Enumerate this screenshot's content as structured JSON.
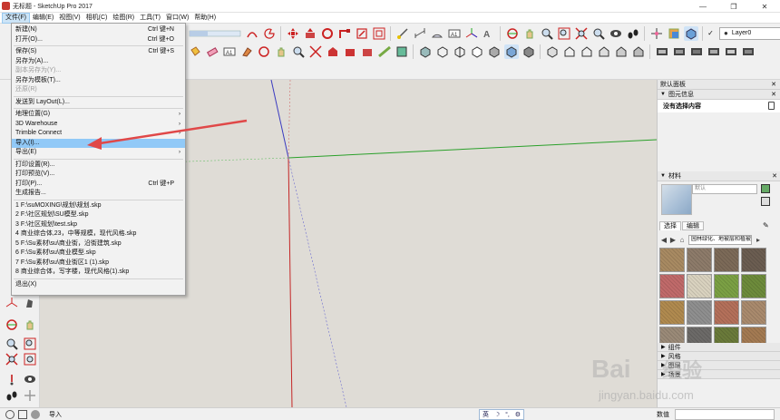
{
  "window": {
    "title": "无标题 - SketchUp Pro 2017",
    "controls": [
      "—",
      "❐",
      "✕"
    ]
  },
  "menubar": [
    "文件(F)",
    "编辑(E)",
    "视图(V)",
    "相机(C)",
    "绘图(R)",
    "工具(T)",
    "窗口(W)",
    "帮助(H)"
  ],
  "file_menu": [
    {
      "label": "新建(N)",
      "shortcut": "Ctrl 键+N"
    },
    {
      "label": "打开(O)...",
      "shortcut": "Ctrl 键+O"
    },
    {
      "sep": true
    },
    {
      "label": "保存(S)",
      "shortcut": "Ctrl 键+S"
    },
    {
      "label": "另存为(A)..."
    },
    {
      "label": "副本另存为(Y)...",
      "disabled": true
    },
    {
      "label": "另存为模板(T)..."
    },
    {
      "label": "还原(R)",
      "disabled": true
    },
    {
      "sep": true
    },
    {
      "label": "发送到 LayOut(L)..."
    },
    {
      "sep": true
    },
    {
      "label": "地理位置(G)",
      "submenu": true
    },
    {
      "label": "3D Warehouse",
      "submenu": true
    },
    {
      "label": "Trimble Connect",
      "submenu": true
    },
    {
      "label": "导入(I)...",
      "highlight": true
    },
    {
      "label": "导出(E)",
      "submenu": true
    },
    {
      "sep": true
    },
    {
      "label": "打印设置(R)..."
    },
    {
      "label": "打印预览(V)..."
    },
    {
      "label": "打印(P)...",
      "shortcut": "Ctrl 键+P"
    },
    {
      "label": "生成报告..."
    },
    {
      "sep": true
    },
    {
      "label": "1 F:\\suMOXING\\规划\\规划.skp"
    },
    {
      "label": "2 F:\\社区规划\\SU模型.skp"
    },
    {
      "label": "3 F:\\社区规划\\test.skp"
    },
    {
      "label": "4 商业综合体,23，中等规模，现代风格.skp"
    },
    {
      "label": "5 F:\\Su素材\\su\\商业街，沿街建筑.skp"
    },
    {
      "label": "6 F:\\Su素材\\su\\商业模型.skp"
    },
    {
      "label": "7 F:\\Su素材\\su\\商业街区1 (1).skp"
    },
    {
      "label": "8 商业综合体，写字楼，现代风格(1).skp"
    },
    {
      "sep": true
    },
    {
      "label": "退出(X)"
    }
  ],
  "layer": {
    "value": "Layer0"
  },
  "tray": {
    "title": "默认面板",
    "entity_info": {
      "header": "图元信息",
      "body": "没有选择内容"
    },
    "materials": {
      "header": "材料",
      "name_placeholder": "默认",
      "tabs": [
        "选择",
        "编辑"
      ],
      "collection": "园林绿化、地被层和植被",
      "swatch_colors": [
        "#a88a62",
        "#8d7b6a",
        "#7c6a58",
        "#6b5d51",
        "#c06a6a",
        "#d9d2bf",
        "#7ba044",
        "#6d8b3b",
        "#b08a4f",
        "#8f8f8f",
        "#b4705a",
        "#a98a6d",
        "#9a8a78",
        "#6c6a68",
        "#6a7a3a",
        "#a37a52"
      ]
    },
    "collapsed": [
      "组件",
      "风格",
      "图层",
      "场景"
    ]
  },
  "status": {
    "text": "导入",
    "measure_label": "数值",
    "ime": [
      "英",
      "☽",
      "°,",
      "⚙"
    ]
  },
  "watermark": {
    "brand": "Bai",
    "brand2": "经验",
    "url": "jingyan.baidu.com"
  },
  "colors": {
    "accent": "#3399ff",
    "highlight": "#91c9f7",
    "viewport": "#dfdcd6",
    "arrow": "#e04848"
  }
}
